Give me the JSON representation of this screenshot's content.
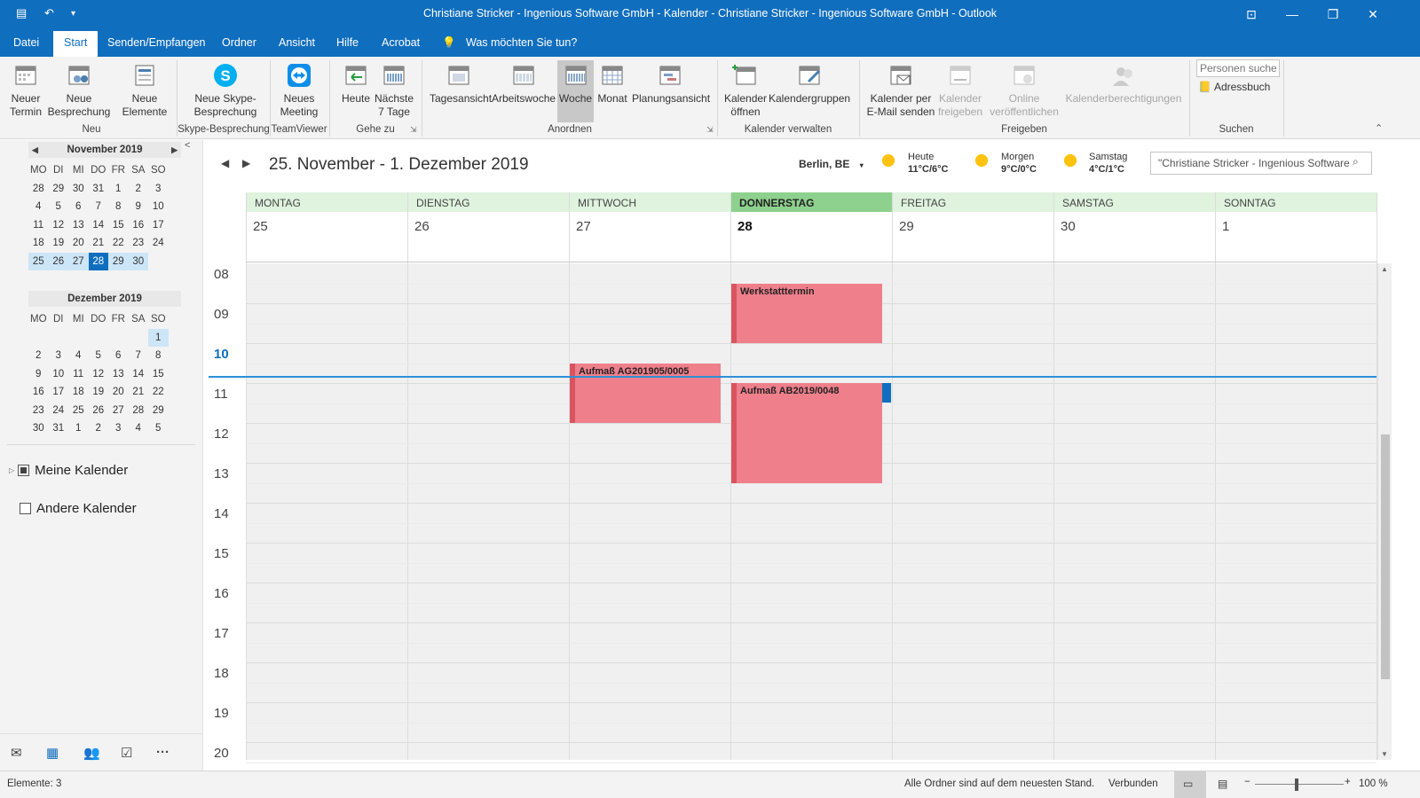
{
  "window": {
    "title": "Christiane Stricker - Ingenious Software GmbH - Kalender - Christiane Stricker - Ingenious Software GmbH  -  Outlook",
    "brand_color": "#106ebe"
  },
  "menu": {
    "tabs": [
      "Datei",
      "Start",
      "Senden/Empfangen",
      "Ordner",
      "Ansicht",
      "Hilfe",
      "Acrobat"
    ],
    "active": "Start",
    "tell_me": "Was möchten Sie tun?"
  },
  "ribbon": {
    "new_appointment": "Neuer Termin",
    "new_meeting": "Neue Besprechung",
    "new_items": "Neue Elemente",
    "group_new": "Neu",
    "skype_meeting": "Neue Skype-Besprechung",
    "group_skype": "Skype-Besprechung",
    "teamviewer_meeting": "Neues Meeting",
    "group_teamviewer": "TeamViewer",
    "today": "Heute",
    "next7": "Nächste 7 Tage",
    "group_goto": "Gehe zu",
    "day_view": "Tagesansicht",
    "work_week": "Arbeitswoche",
    "week": "Woche",
    "month": "Monat",
    "schedule_view": "Planungsansicht",
    "group_arrange": "Anordnen",
    "open_calendar": "Kalender öffnen",
    "calendar_groups": "Kalendergruppen",
    "group_manage": "Kalender verwalten",
    "email_calendar": "Kalender per E-Mail senden",
    "share_calendar": "Kalender freigeben",
    "publish_online": "Online veröffentlichen",
    "calendar_permissions": "Kalenderberechtigungen",
    "group_share": "Freigeben",
    "search_people_placeholder": "Personen suchen",
    "address_book": "Adressbuch",
    "group_find": "Suchen"
  },
  "sidebar": {
    "november": {
      "title": "November 2019",
      "dow": [
        "MO",
        "DI",
        "MI",
        "DO",
        "FR",
        "SA",
        "SO"
      ],
      "weeks": [
        [
          "28",
          "29",
          "30",
          "31",
          "1",
          "2",
          "3"
        ],
        [
          "4",
          "5",
          "6",
          "7",
          "8",
          "9",
          "10"
        ],
        [
          "11",
          "12",
          "13",
          "14",
          "15",
          "16",
          "17"
        ],
        [
          "18",
          "19",
          "20",
          "21",
          "22",
          "23",
          "24"
        ],
        [
          "25",
          "26",
          "27",
          "28",
          "29",
          "30",
          ""
        ]
      ]
    },
    "december": {
      "title": "Dezember 2019",
      "dow": [
        "MO",
        "DI",
        "MI",
        "DO",
        "FR",
        "SA",
        "SO"
      ],
      "weeks": [
        [
          "",
          "",
          "",
          "",
          "",
          "",
          "1"
        ],
        [
          "2",
          "3",
          "4",
          "5",
          "6",
          "7",
          "8"
        ],
        [
          "9",
          "10",
          "11",
          "12",
          "13",
          "14",
          "15"
        ],
        [
          "16",
          "17",
          "18",
          "19",
          "20",
          "21",
          "22"
        ],
        [
          "23",
          "24",
          "25",
          "26",
          "27",
          "28",
          "29"
        ],
        [
          "30",
          "31",
          "1",
          "2",
          "3",
          "4",
          "5"
        ]
      ]
    },
    "my_calendars": "Meine Kalender",
    "other_calendars": "Andere Kalender"
  },
  "calendar": {
    "range_title": "25. November - 1. Dezember 2019",
    "location": "Berlin, BE",
    "weather": [
      {
        "day": "Heute",
        "temp": "11°C/6°C"
      },
      {
        "day": "Morgen",
        "temp": "9°C/0°C"
      },
      {
        "day": "Samstag",
        "temp": "4°C/1°C"
      }
    ],
    "search_placeholder": "\"Christiane Stricker - Ingenious Software",
    "days": [
      {
        "name": "MONTAG",
        "num": "25"
      },
      {
        "name": "DIENSTAG",
        "num": "26"
      },
      {
        "name": "MITTWOCH",
        "num": "27"
      },
      {
        "name": "DONNERSTAG",
        "num": "28",
        "today": true
      },
      {
        "name": "FREITAG",
        "num": "29"
      },
      {
        "name": "SAMSTAG",
        "num": "30"
      },
      {
        "name": "SONNTAG",
        "num": "1"
      }
    ],
    "hours": [
      "08",
      "09",
      "10",
      "11",
      "12",
      "13",
      "14",
      "15",
      "16",
      "17",
      "18",
      "19",
      "20"
    ],
    "current_hour": "10",
    "events": [
      {
        "title": "Werkstatttermin",
        "day": "DONNERSTAG",
        "start": "08:30",
        "end": "10:00"
      },
      {
        "title": "Aufmaß AG201905/0005",
        "day": "MITTWOCH",
        "start": "10:30",
        "end": "12:00"
      },
      {
        "title": "Aufmaß AB2019/0048",
        "day": "DONNERSTAG",
        "start": "11:00",
        "end": "13:30"
      }
    ],
    "event_color": "#ef7f8b",
    "today_header_color": "#8ed18e"
  },
  "statusbar": {
    "items_count": "Elemente: 3",
    "sync_status": "Alle Ordner sind auf dem neuesten Stand.",
    "connection": "Verbunden",
    "zoom": "100 %"
  }
}
